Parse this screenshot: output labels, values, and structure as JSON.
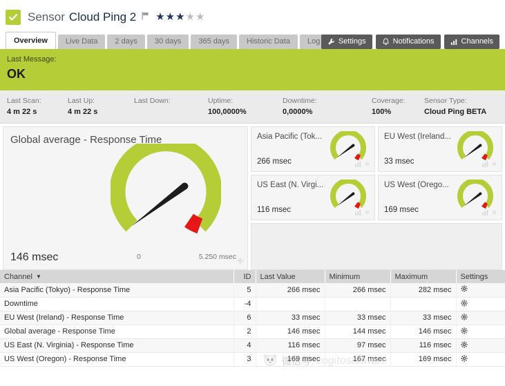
{
  "header": {
    "status_icon": "check-icon",
    "kind": "Sensor",
    "name": "Cloud Ping 2",
    "flag_icon": "flag-icon",
    "rating": 3,
    "rating_max": 5,
    "accent_green": "#b5ce38",
    "star_color": "#23365e"
  },
  "tabs": [
    {
      "label": "Overview",
      "active": true
    },
    {
      "label": "Live Data",
      "active": false
    },
    {
      "label": "2 days",
      "active": false
    },
    {
      "label": "30 days",
      "active": false
    },
    {
      "label": "365 days",
      "active": false
    },
    {
      "label": "Historic Data",
      "active": false
    },
    {
      "label": "Log",
      "active": false
    }
  ],
  "toolbar_buttons": [
    {
      "label": "Settings",
      "icon": "wrench-icon"
    },
    {
      "label": "Notifications",
      "icon": "bell-icon"
    },
    {
      "label": "Channels",
      "icon": "bar-chart-icon"
    }
  ],
  "banner": {
    "label": "Last Message:",
    "value": "OK",
    "color": "#b5ce38"
  },
  "stats": [
    {
      "label": "Last Scan:",
      "value": "4 m 22 s"
    },
    {
      "label": "Last Up:",
      "value": "4 m 22 s"
    },
    {
      "label": "Last Down:",
      "value": ""
    },
    {
      "label": "Uptime:",
      "value": "100,0000%"
    },
    {
      "label": "Downtime:",
      "value": "0,0000%"
    },
    {
      "label": "Coverage:",
      "value": "100%"
    },
    {
      "label": "Sensor Type:",
      "value": "Cloud Ping BETA"
    }
  ],
  "main_gauge": {
    "title": "Global average - Response Time",
    "value": "146 msec",
    "min_label": "0",
    "max_label": "5.250 msec",
    "value_number": 146,
    "range_min": 0,
    "range_max": 5250,
    "arc_color": "#b5ce38",
    "alarm_color": "#e51717",
    "needle_color": "#1d1d1d",
    "settings_icon": "gear-icon"
  },
  "small_gauges": [
    {
      "title": "Asia Pacific (Tok...",
      "value": "266 msec",
      "value_number": 266
    },
    {
      "title": "EU West (Ireland...",
      "value": "33 msec",
      "value_number": 33
    },
    {
      "title": "US East (N. Virgi...",
      "value": "116 msec",
      "value_number": 116
    },
    {
      "title": "US West (Orego...",
      "value": "169 msec",
      "value_number": 169
    }
  ],
  "table": {
    "columns": [
      {
        "label": "Channel",
        "sort": "desc",
        "align": "left"
      },
      {
        "label": "ID",
        "align": "right"
      },
      {
        "label": "Last Value",
        "align": "right"
      },
      {
        "label": "Minimum",
        "align": "right"
      },
      {
        "label": "Maximum",
        "align": "right"
      },
      {
        "label": "Settings",
        "align": "left"
      }
    ],
    "rows": [
      {
        "channel": "Asia Pacific (Tokyo) - Response Time",
        "id": "5",
        "last": "266 msec",
        "min": "266 msec",
        "max": "282 msec",
        "settings_icon": "gear-icon"
      },
      {
        "channel": "Downtime",
        "id": "-4",
        "last": "",
        "min": "",
        "max": "",
        "settings_icon": "gear-icon"
      },
      {
        "channel": "EU West (Ireland) - Response Time",
        "id": "6",
        "last": "33 msec",
        "min": "33 msec",
        "max": "33 msec",
        "settings_icon": "gear-icon"
      },
      {
        "channel": "Global average - Response Time",
        "id": "2",
        "last": "146 msec",
        "min": "144 msec",
        "max": "146 msec",
        "settings_icon": "gear-icon"
      },
      {
        "channel": "US East (N. Virginia) - Response Time",
        "id": "4",
        "last": "116 msec",
        "min": "97 msec",
        "max": "116 msec",
        "settings_icon": "gear-icon"
      },
      {
        "channel": "US West (Oregon) - Response Time",
        "id": "3",
        "last": "169 msec",
        "min": "167 msec",
        "max": "169 msec",
        "settings_icon": "gear-icon"
      }
    ]
  },
  "watermark": {
    "icon": "panda-face-icon",
    "text": "微信号:",
    "text2": "cogitosoftware"
  }
}
